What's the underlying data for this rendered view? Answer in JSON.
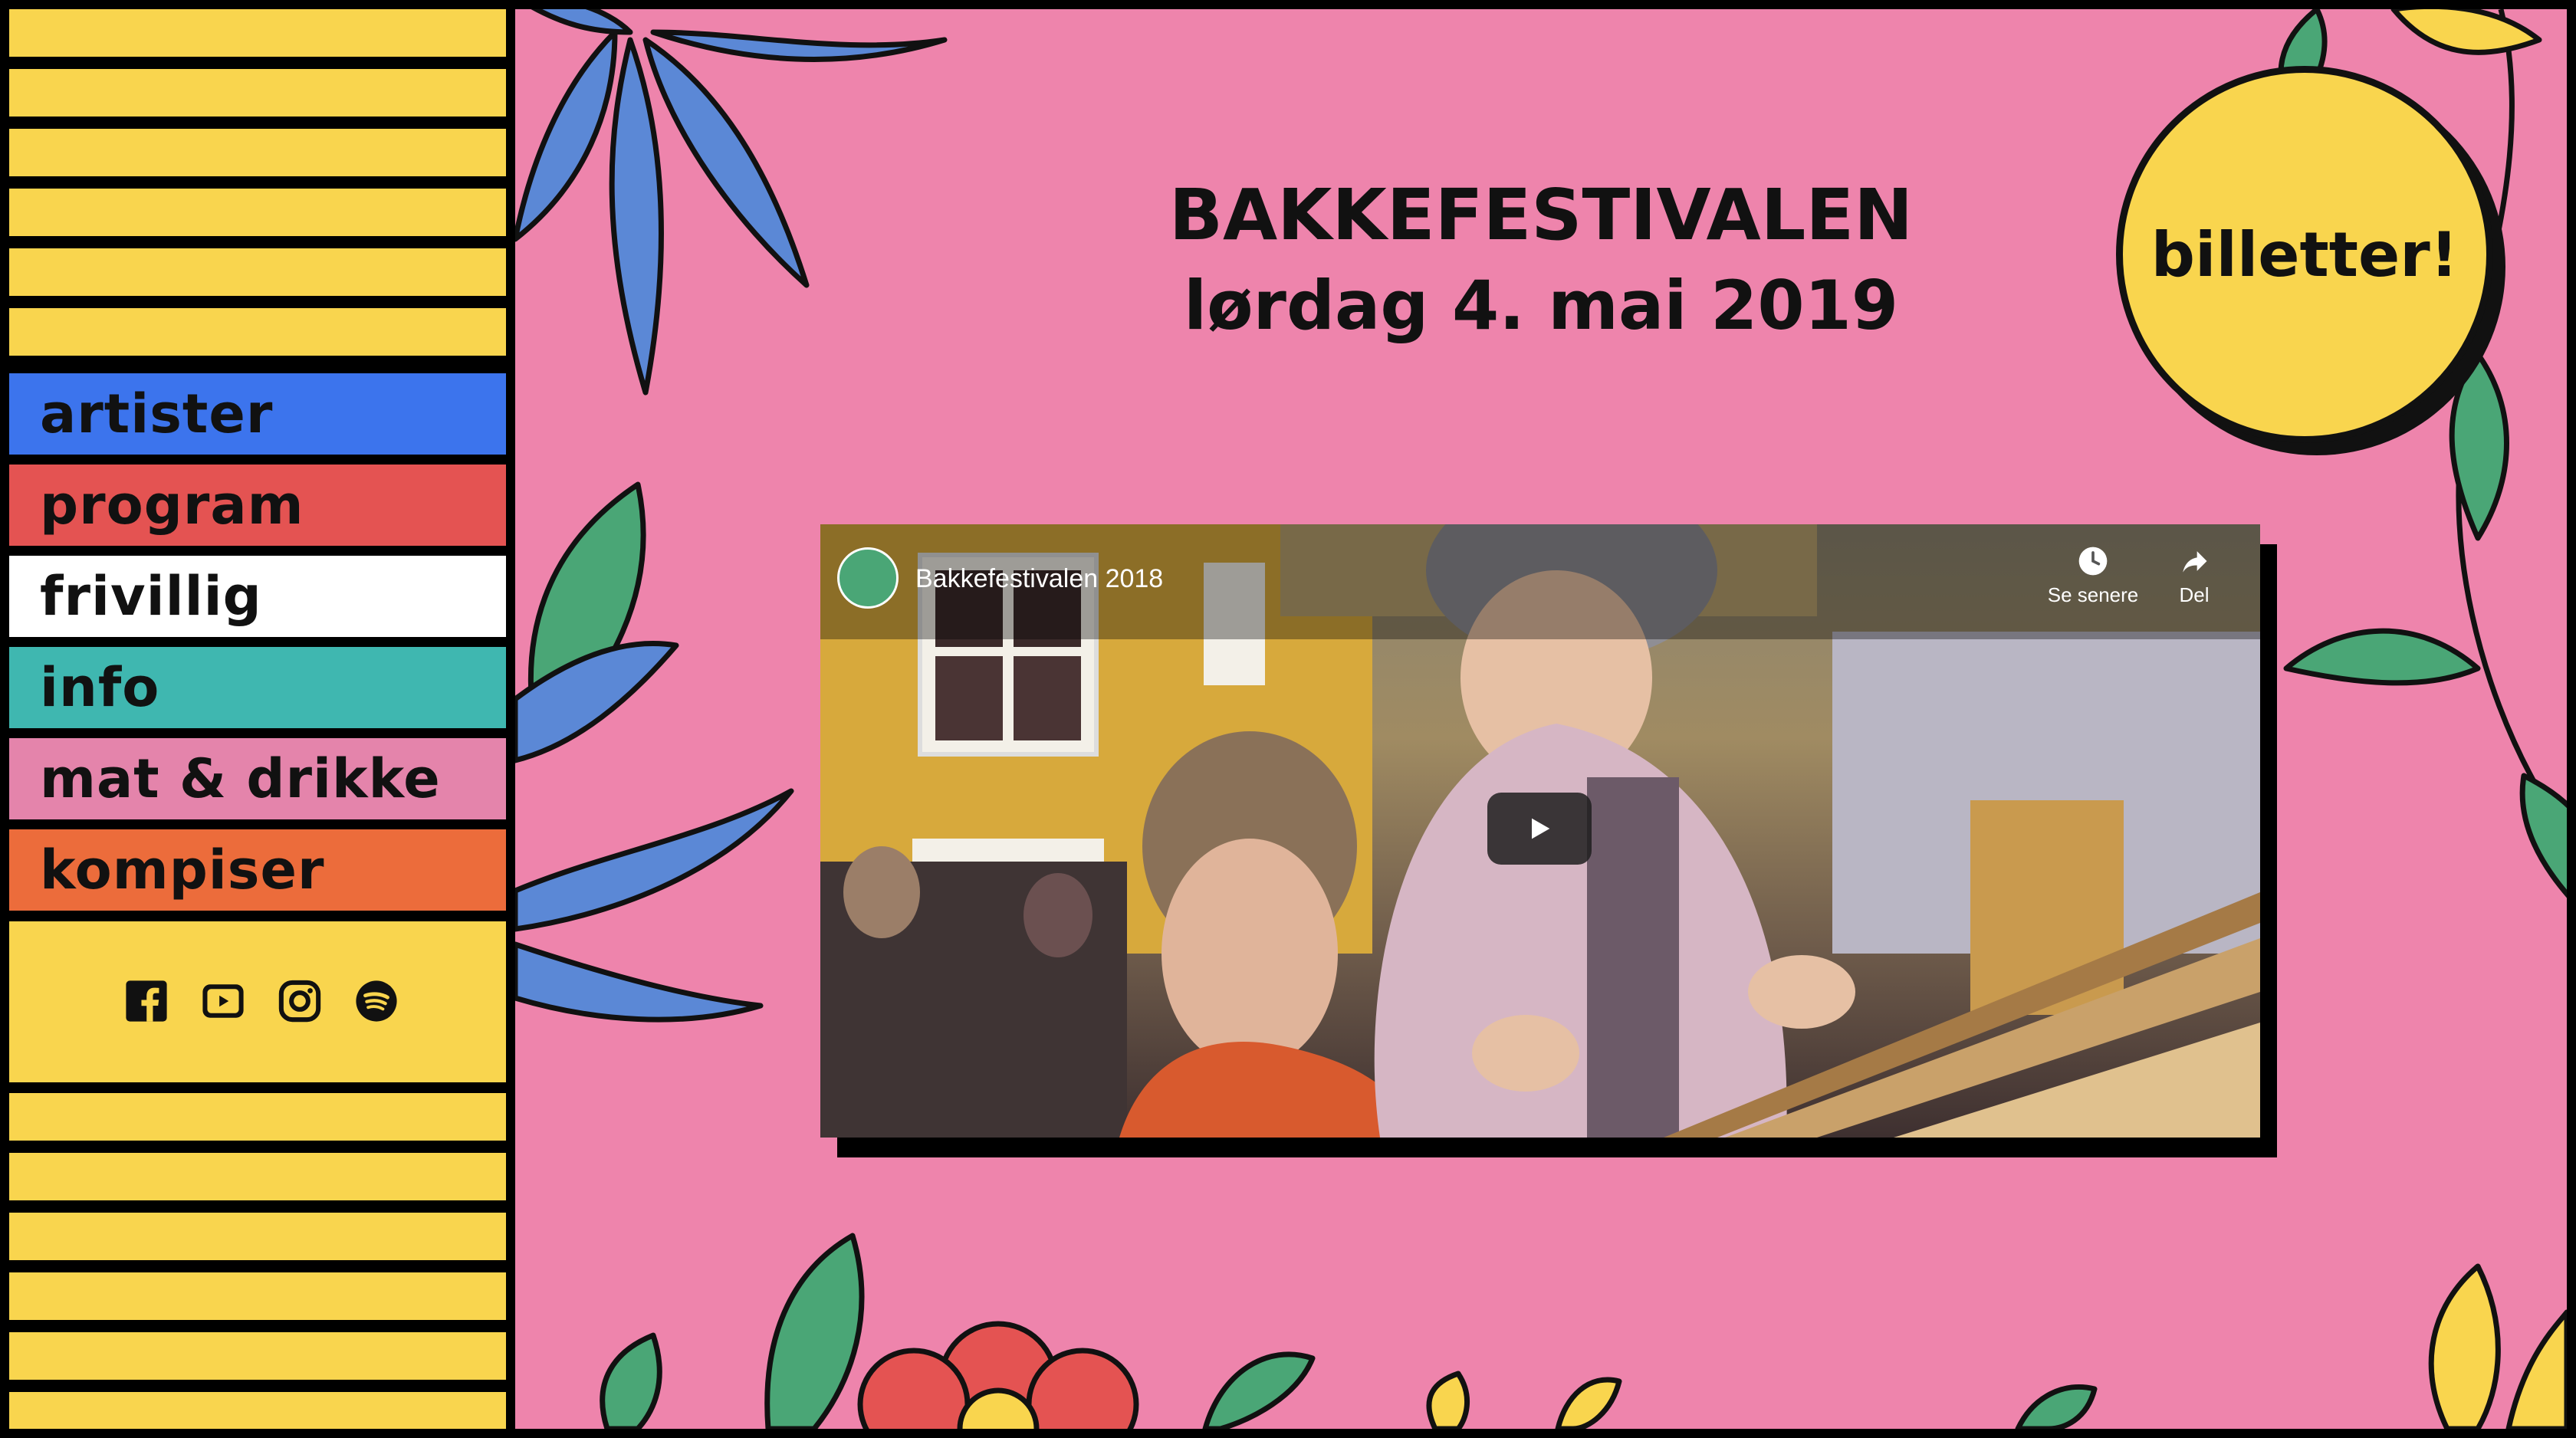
{
  "festival": {
    "title": "BAKKEFESTIVALEN",
    "date": "lørdag 4. mai 2019"
  },
  "tickets_label": "billetter!",
  "nav": {
    "items": [
      {
        "label": "artister",
        "color": "#3c74ed"
      },
      {
        "label": "program",
        "color": "#e45352"
      },
      {
        "label": "frivillig",
        "color": "#ffffff"
      },
      {
        "label": "info",
        "color": "#3fb7b0"
      },
      {
        "label": "mat & drikke",
        "color": "#e484ab"
      },
      {
        "label": "kompiser",
        "color": "#ec6c3b"
      }
    ]
  },
  "social": [
    "facebook-icon",
    "youtube-icon",
    "instagram-icon",
    "spotify-icon"
  ],
  "video": {
    "title": "Bakkefestivalen 2018",
    "watch_later": "Se senere",
    "share": "Del"
  },
  "colors": {
    "pink": "#ee84ac",
    "yellow": "#f9d54e",
    "blue": "#5b88d6",
    "green": "#4aa676",
    "red": "#e45352"
  }
}
